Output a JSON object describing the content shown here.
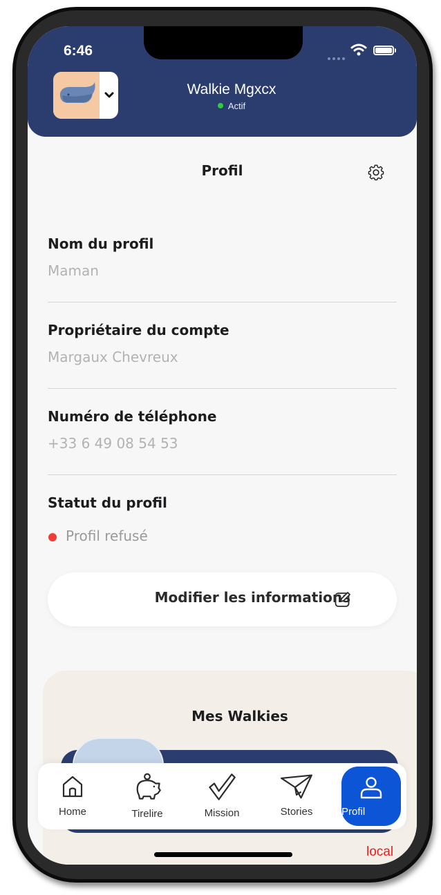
{
  "status_bar": {
    "time": "6:46"
  },
  "header": {
    "device_name": "Walkie Mgxcx",
    "device_status": "Actif"
  },
  "page": {
    "title": "Profil"
  },
  "fields": [
    {
      "label": "Nom du profil",
      "value": "Maman"
    },
    {
      "label": "Propriétaire du compte",
      "value": "Margaux Chevreux"
    },
    {
      "label": "Numéro de téléphone",
      "value": "+33 6 49 08 54 53"
    }
  ],
  "profile_status": {
    "label": "Statut du profil",
    "value": "Profil refusé",
    "color": "#f03c34"
  },
  "edit_button": {
    "label": "Modifier les informations"
  },
  "walkies": {
    "title": "Mes Walkies"
  },
  "tabs": [
    {
      "label": "Home",
      "icon": "home-icon"
    },
    {
      "label": "Tirelire",
      "icon": "piggy-bank-icon"
    },
    {
      "label": "Mission",
      "icon": "checkmark-icon"
    },
    {
      "label": "Stories",
      "icon": "paper-plane-icon"
    },
    {
      "label": "Profil",
      "icon": "user-icon",
      "active": true
    }
  ],
  "environment_label": "local",
  "colors": {
    "header": "#2b3d6e",
    "active_tab": "#0b55d6",
    "status_active": "#2ecc40",
    "walkies_card": "#f3efe8"
  }
}
